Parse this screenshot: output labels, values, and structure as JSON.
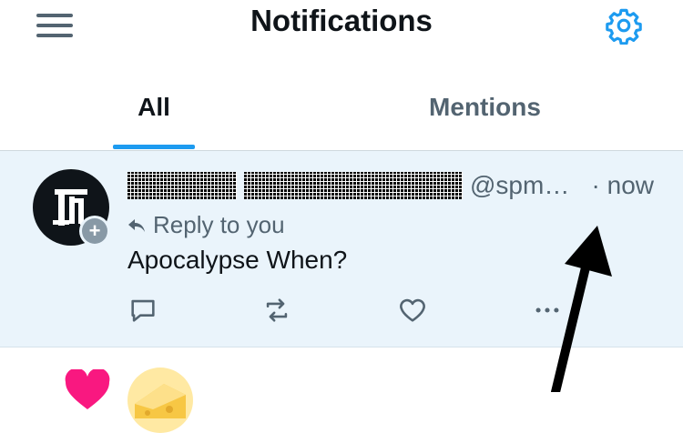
{
  "header": {
    "title": "Notifications",
    "menu_icon": "hamburger-menu-icon",
    "settings_icon": "gear-icon"
  },
  "tabs": [
    {
      "label": "All",
      "active": true
    },
    {
      "label": "Mentions",
      "active": false
    }
  ],
  "notification": {
    "avatar_icon": "blackletter-logo-avatar",
    "handle": "@spm…",
    "time": "· now",
    "reply_label": "Reply to you",
    "text": "Apocalypse When?",
    "actions": [
      "reply-icon",
      "retweet-icon",
      "like-icon",
      "more-icon"
    ]
  },
  "next_notification": {
    "icon": "heart-icon",
    "avatar_icon": "cheese-emoji-avatar"
  },
  "colors": {
    "accent": "#1d9bf0",
    "unread_bg": "#eaf4fb",
    "secondary_text": "#536471",
    "like_pink": "#f91880"
  },
  "annotation": {
    "arrow_icon": "black-arrow-pointing-at-timestamp"
  }
}
